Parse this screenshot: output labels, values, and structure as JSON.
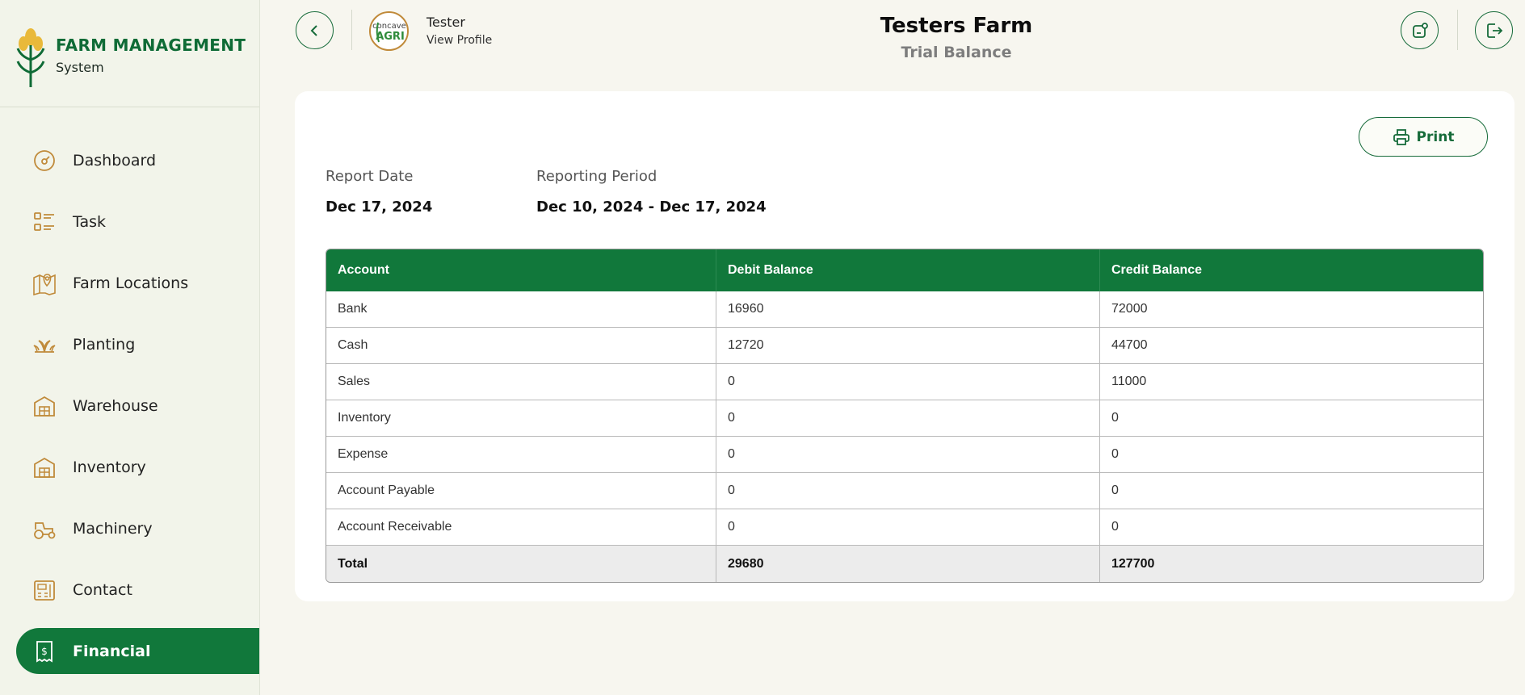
{
  "brand": {
    "title": "FARM MANAGEMENT",
    "subtitle": "System"
  },
  "sidebar": {
    "items": [
      {
        "label": "Dashboard",
        "icon": "gauge-icon",
        "active": false
      },
      {
        "label": "Task",
        "icon": "task-list-icon",
        "active": false
      },
      {
        "label": "Farm Locations",
        "icon": "map-pin-icon",
        "active": false
      },
      {
        "label": "Planting",
        "icon": "sprout-icon",
        "active": false
      },
      {
        "label": "Warehouse",
        "icon": "warehouse-icon",
        "active": false
      },
      {
        "label": "Inventory",
        "icon": "inventory-icon",
        "active": false
      },
      {
        "label": "Machinery",
        "icon": "tractor-icon",
        "active": false
      },
      {
        "label": "Contact",
        "icon": "contact-icon",
        "active": false
      },
      {
        "label": "Financial",
        "icon": "receipt-dollar-icon",
        "active": true
      }
    ]
  },
  "header": {
    "user_name": "Tester",
    "view_profile": "View Profile",
    "avatar_text_top": "concave",
    "avatar_text_bottom": "AGRI",
    "farm_title": "Testers Farm",
    "page_subtitle": "Trial Balance"
  },
  "report": {
    "print_label": "Print",
    "report_date_label": "Report Date",
    "report_date_value": "Dec 17, 2024",
    "period_label": "Reporting Period",
    "period_value": "Dec 10, 2024 - Dec 17, 2024"
  },
  "table": {
    "headers": [
      "Account",
      "Debit Balance",
      "Credit Balance"
    ],
    "rows": [
      [
        "Bank",
        "16960",
        "72000"
      ],
      [
        "Cash",
        "12720",
        "44700"
      ],
      [
        "Sales",
        "0",
        "11000"
      ],
      [
        "Inventory",
        "0",
        "0"
      ],
      [
        "Expense",
        "0",
        "0"
      ],
      [
        "Account Payable",
        "0",
        "0"
      ],
      [
        "Account Receivable",
        "0",
        "0"
      ]
    ],
    "total": [
      "Total",
      "29680",
      "127700"
    ]
  },
  "colors": {
    "primary": "#11783b",
    "accent": "#c08a3a",
    "background": "#f7f6ef"
  }
}
